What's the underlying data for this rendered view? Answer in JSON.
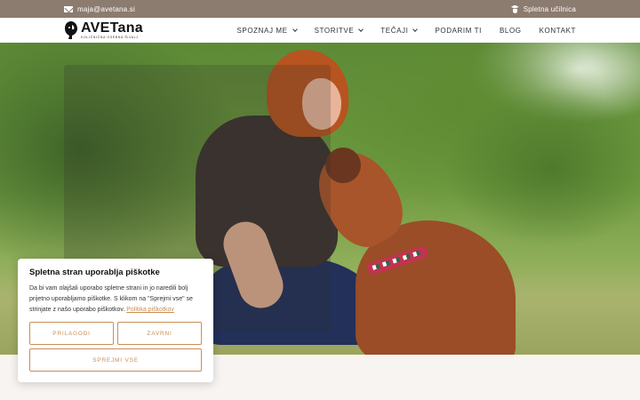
{
  "topbar": {
    "email": "maja@avetana.si",
    "email_icon": "mail-icon",
    "school_label": "Spletna učilnica",
    "school_icon": "graduation-cap-icon"
  },
  "header": {
    "logo_text": "AVETana",
    "logo_subtitle": "KOLIČNIČNA OSEBNA ŠIVALJ",
    "nav": [
      {
        "label": "SPOZNAJ ME",
        "dropdown": true
      },
      {
        "label": "STORITVE",
        "dropdown": true
      },
      {
        "label": "TEČAJI",
        "dropdown": true
      },
      {
        "label": "PODARIM TI",
        "dropdown": false
      },
      {
        "label": "BLOG",
        "dropdown": false
      },
      {
        "label": "KONTAKT",
        "dropdown": false
      }
    ]
  },
  "cookie": {
    "title": "Spletna stran uporablja piškotke",
    "text": "Da bi vam olajšali uporabo spletne strani in jo naredili bolj prijetno uporabljamo piškotke. S klikom na \"Sprejmi vse\" se strinjate z našo uporabo piškotkov.",
    "policy_link": "Politika piškotkov",
    "customize_label": "PRILAGODI",
    "reject_label": "ZAVRNI",
    "accept_all_label": "SPREJMI VSE"
  },
  "colors": {
    "topbar_bg": "#8c7b6f",
    "accent": "#c98e57"
  }
}
